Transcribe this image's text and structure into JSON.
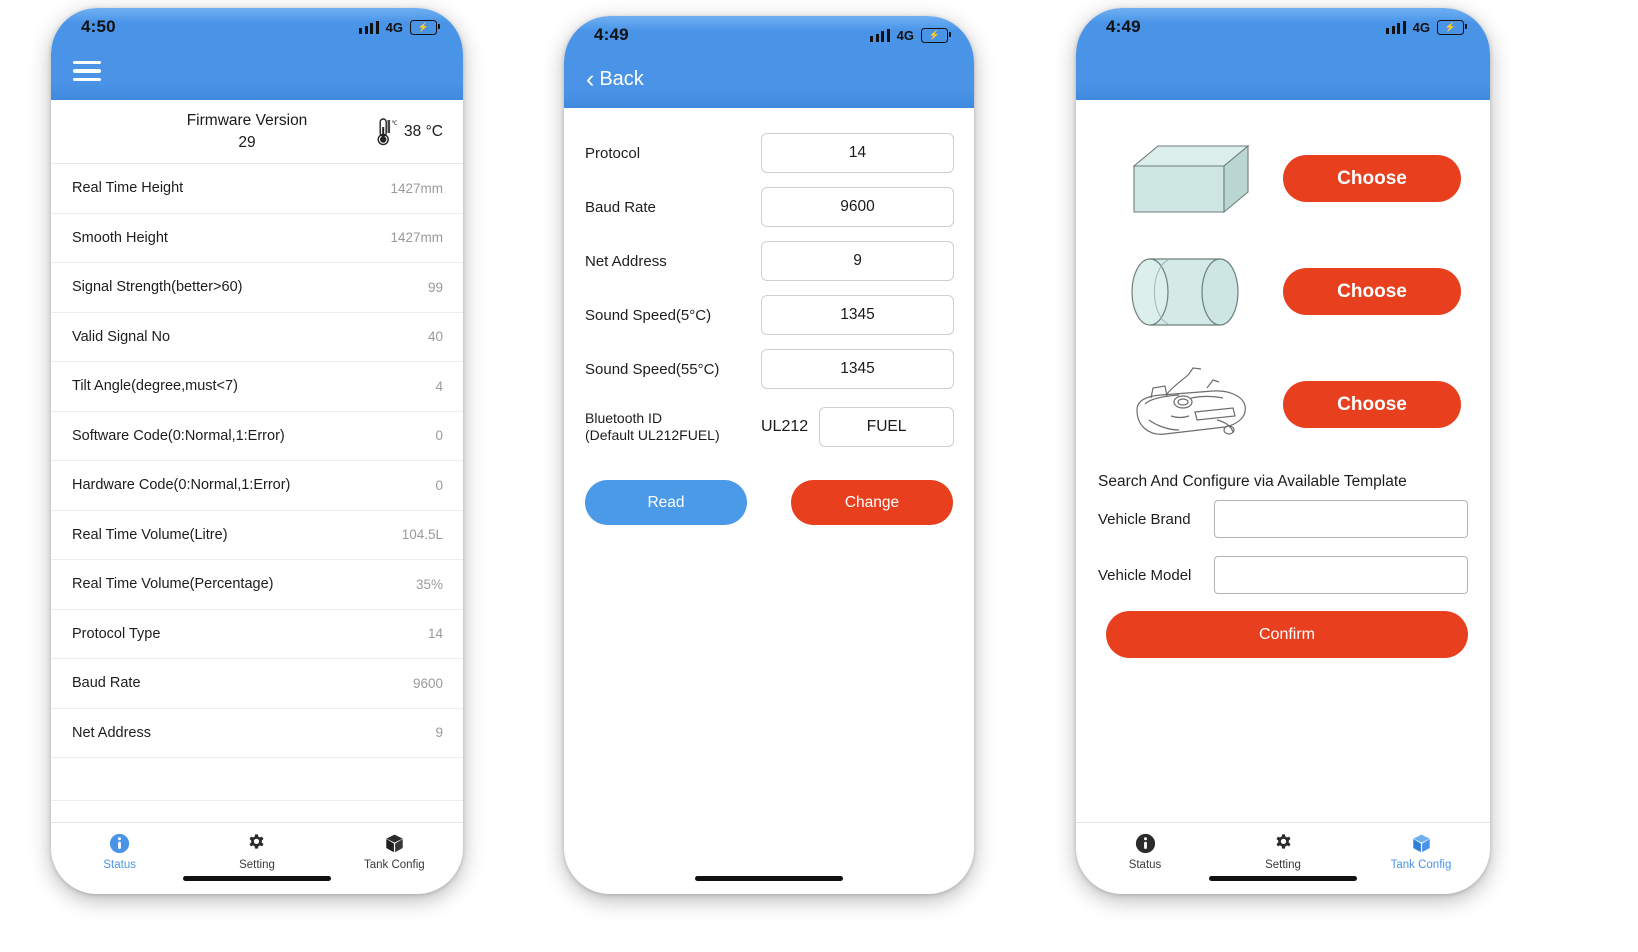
{
  "app": {
    "accent_blue": "#4a94e8",
    "accent_red": "#e8401e",
    "muted_value": "#9a9a9a"
  },
  "tabs": {
    "status": "Status",
    "setting": "Setting",
    "tank_config": "Tank Config"
  },
  "phone1": {
    "status_bar": {
      "time": "4:50",
      "network": "4G",
      "battery_icon": "battery-charging-icon"
    },
    "nav": {
      "menu_icon": "hamburger-menu-icon"
    },
    "header_card": {
      "title": "Firmware Version",
      "value": "29",
      "temp_icon": "thermometer-icon",
      "temperature": "38 °C"
    },
    "rows": [
      {
        "label": "Real Time Height",
        "value": "1427mm"
      },
      {
        "label": "Smooth Height",
        "value": "1427mm"
      },
      {
        "label": "Signal Strength(better>60)",
        "value": "99"
      },
      {
        "label": "Valid Signal No",
        "value": "40"
      },
      {
        "label": "Tilt Angle(degree,must<7)",
        "value": "4"
      },
      {
        "label": "Software Code(0:Normal,1:Error)",
        "value": "0"
      },
      {
        "label": "Hardware Code(0:Normal,1:Error)",
        "value": "0"
      },
      {
        "label": "Real Time Volume(Litre)",
        "value": "104.5L"
      },
      {
        "label": "Real Time Volume(Percentage)",
        "value": "35%"
      },
      {
        "label": "Protocol Type",
        "value": "14"
      },
      {
        "label": "Baud Rate",
        "value": "9600"
      },
      {
        "label": "Net Address",
        "value": "9"
      }
    ],
    "active_tab": "Status"
  },
  "phone2": {
    "status_bar": {
      "time": "4:49",
      "network": "4G",
      "battery_icon": "battery-charging-icon"
    },
    "nav": {
      "back_label": "Back",
      "back_icon": "chevron-left-icon"
    },
    "fields": [
      {
        "label": "Protocol",
        "value": "14"
      },
      {
        "label": "Baud Rate",
        "value": "9600"
      },
      {
        "label": "Net Address",
        "value": "9"
      },
      {
        "label": "Sound Speed(5°C)",
        "value": "1345"
      },
      {
        "label": "Sound Speed(55°C)",
        "value": "1345"
      }
    ],
    "bluetooth": {
      "label_line1": "Bluetooth ID",
      "label_line2": "(Default UL212FUEL)",
      "prefix": "UL212",
      "value": "FUEL"
    },
    "buttons": {
      "read": "Read",
      "change": "Change"
    }
  },
  "phone3": {
    "status_bar": {
      "time": "4:49",
      "network": "4G",
      "battery_icon": "battery-charging-icon"
    },
    "tank_options": [
      {
        "shape": "cuboid-tank-icon",
        "choose_label": "Choose"
      },
      {
        "shape": "cylinder-tank-icon",
        "choose_label": "Choose"
      },
      {
        "shape": "vehicle-fuel-tank-icon",
        "choose_label": "Choose"
      }
    ],
    "search_section": {
      "title": "Search And Configure via Available Template",
      "brand_label": "Vehicle Brand",
      "brand_value": "",
      "model_label": "Vehicle Model",
      "model_value": "",
      "confirm_label": "Confirm"
    },
    "active_tab": "Tank Config"
  }
}
